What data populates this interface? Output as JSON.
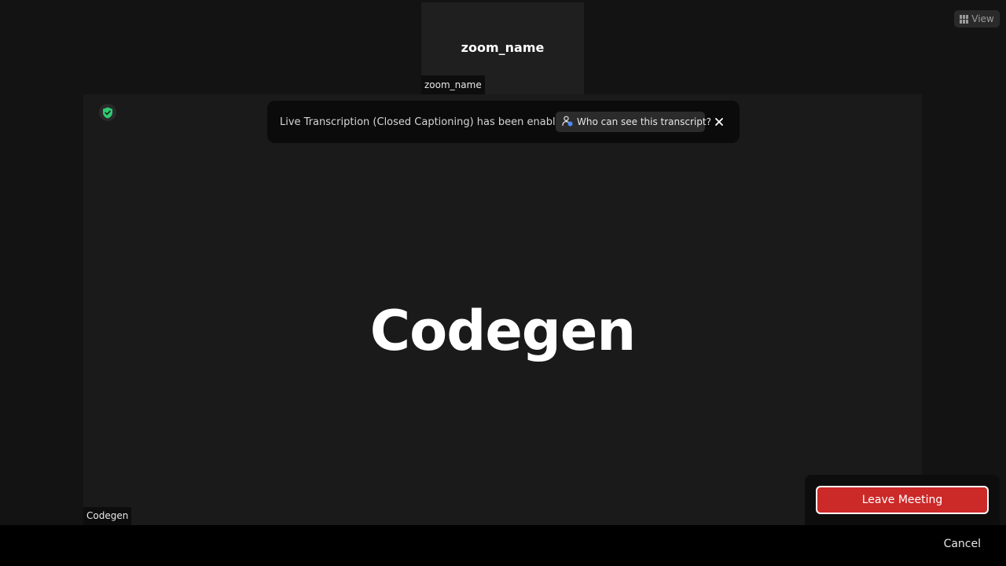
{
  "thumbnail": {
    "name": "zoom_name",
    "label": "zoom_name"
  },
  "view_button": {
    "label": "View",
    "icon": "grid-icon"
  },
  "main_tile": {
    "name": "Codegen",
    "label": "Codegen",
    "encryption_icon": "shield-check-icon"
  },
  "banner": {
    "message": "Live Transcription (Closed Captioning) has been enabled",
    "who_can_see_label": "Who can see this transcript?",
    "close_icon": "close-icon"
  },
  "leave_panel": {
    "leave_label": "Leave Meeting"
  },
  "bottom_bar": {
    "cancel_label": "Cancel"
  },
  "colors": {
    "background": "#131313",
    "tile": "#1a1a1a",
    "leave_button": "#cc2929",
    "shield": "#2ecc71",
    "people_badge": "#4a8cff"
  }
}
